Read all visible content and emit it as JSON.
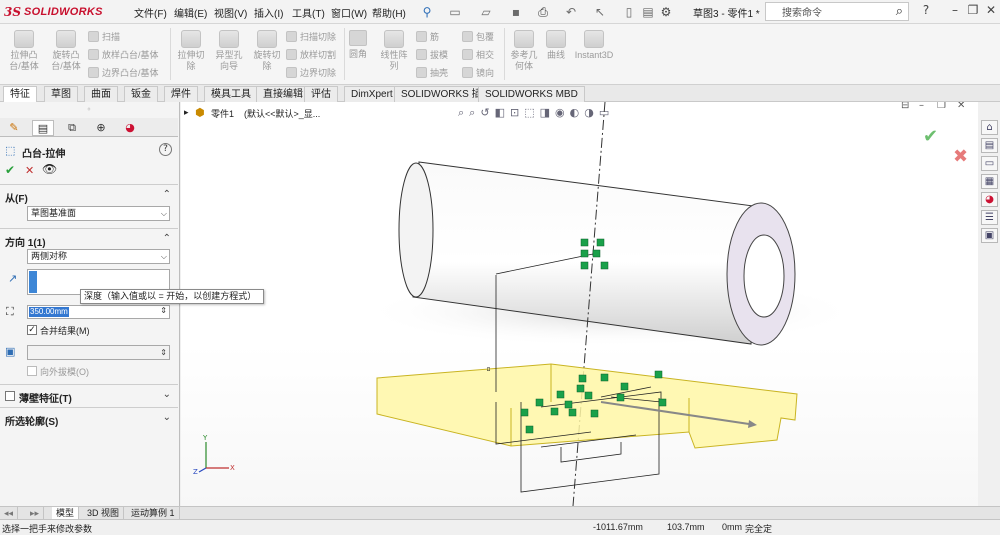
{
  "app": {
    "brand": "SOLIDWORKS",
    "doc_title": "草图3 - 零件1 *"
  },
  "menu": [
    "文件(F)",
    "编辑(E)",
    "视图(V)",
    "插入(I)",
    "工具(T)",
    "窗口(W)",
    "帮助(H)"
  ],
  "search": {
    "placeholder": "搜索命令"
  },
  "ribbon": {
    "large": [
      {
        "label1": "拉伸凸",
        "label2": "台/基体"
      },
      {
        "label1": "旋转凸",
        "label2": "台/基体"
      },
      {
        "label1": "拉伸切",
        "label2": "除"
      },
      {
        "label1": "异型孔",
        "label2": "向导"
      },
      {
        "label1": "旋转切",
        "label2": "除"
      },
      {
        "label1": "线性阵",
        "label2": "列"
      },
      {
        "label1": "参考几",
        "label2": "何体"
      },
      {
        "label1": "曲线",
        "label2": ""
      },
      {
        "label1": "Instant3D",
        "label2": ""
      }
    ],
    "small": [
      "扫描",
      "放样凸台/基体",
      "边界凸台/基体",
      "扫描切除",
      "放样切割",
      "边界切除",
      "圆角",
      "筋",
      "拔模",
      "抽壳",
      "包覆",
      "相交",
      "镜向"
    ]
  },
  "cmd_tabs": [
    "特征",
    "草图",
    "曲面",
    "钣金",
    "焊件",
    "模具工具",
    "直接编辑",
    "评估",
    "DimXpert",
    "SOLIDWORKS 插件",
    "SOLIDWORKS MBD"
  ],
  "active_cmd_tab": "特征",
  "feature_panel": {
    "title": "凸台-拉伸",
    "from_label": "从(F)",
    "from_value": "草图基准面",
    "direction_label": "方向 1(1)",
    "direction_type": "两侧对称",
    "depth_value": "350.00mm",
    "merge_label": "合并结果(M)",
    "draft_label": "向外拔模(O)",
    "thin_label": "薄壁特征(T)",
    "contours_label": "所选轮廓(S)"
  },
  "tooltip": "深度（输入值或以 = 开始，以创建方程式）",
  "tree": {
    "part_label": "零件1",
    "config": "(默认<<默认>_显..."
  },
  "bottom_tabs": [
    "模型",
    "3D 视图",
    "运动算例 1"
  ],
  "status": {
    "hint": "选择一把手来修改参数",
    "x": "-1011.67mm",
    "y": "103.7mm",
    "z": "0mm",
    "state": "完全定"
  },
  "colors": {
    "accent": "#c8102e",
    "sketch_yellow": "#fff7a6",
    "handle_green": "#1aa14a"
  }
}
